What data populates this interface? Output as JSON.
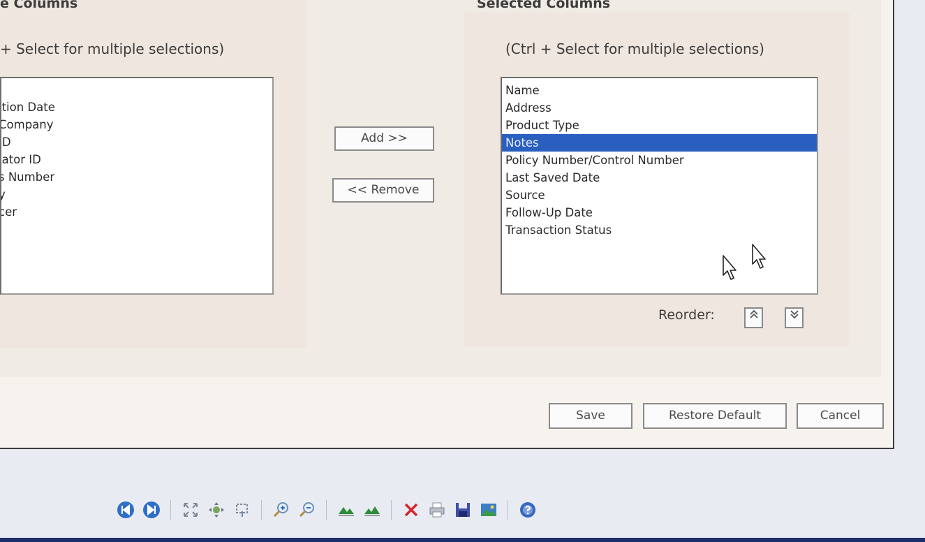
{
  "available_columns": {
    "heading": "e Columns",
    "hint": "+ Select for multiple selections)",
    "items": [
      "",
      "ition Date",
      "Company",
      " ID",
      "iator ID",
      "s Number",
      "y",
      "cer"
    ]
  },
  "selected_columns": {
    "heading": "Selected Columns",
    "hint": "(Ctrl + Select for multiple selections)",
    "items": [
      {
        "label": "Name",
        "selected": false
      },
      {
        "label": "Address",
        "selected": false
      },
      {
        "label": "Product Type",
        "selected": false
      },
      {
        "label": "Notes",
        "selected": true
      },
      {
        "label": "Policy Number/Control Number",
        "selected": false
      },
      {
        "label": "Last Saved Date",
        "selected": false
      },
      {
        "label": "Source",
        "selected": false
      },
      {
        "label": "Follow-Up Date",
        "selected": false
      },
      {
        "label": "Transaction Status",
        "selected": false
      }
    ]
  },
  "transfer": {
    "add_label": "Add >>",
    "remove_label": "<< Remove"
  },
  "reorder": {
    "label": "Reorder:",
    "up_icon": "double-chevron-up-icon",
    "down_icon": "double-chevron-down-icon"
  },
  "actions": {
    "save_label": "Save",
    "restore_default_label": "Restore Default",
    "cancel_label": "Cancel"
  },
  "toolbar": {
    "icons": [
      "first-page-icon",
      "last-page-icon",
      "fit-page-icon",
      "move-icon",
      "select-icon",
      "zoom-in-icon",
      "zoom-out-icon",
      "mountain-icon",
      "mountain-alt-icon",
      "delete-icon",
      "print-icon",
      "save-icon",
      "image-icon",
      "help-icon"
    ]
  },
  "colors": {
    "selection": "#2a5fbf",
    "dialog_bg": "#f6f2ee",
    "panel_bg": "#efe6df",
    "bottom_bar": "#1e2e6a"
  }
}
